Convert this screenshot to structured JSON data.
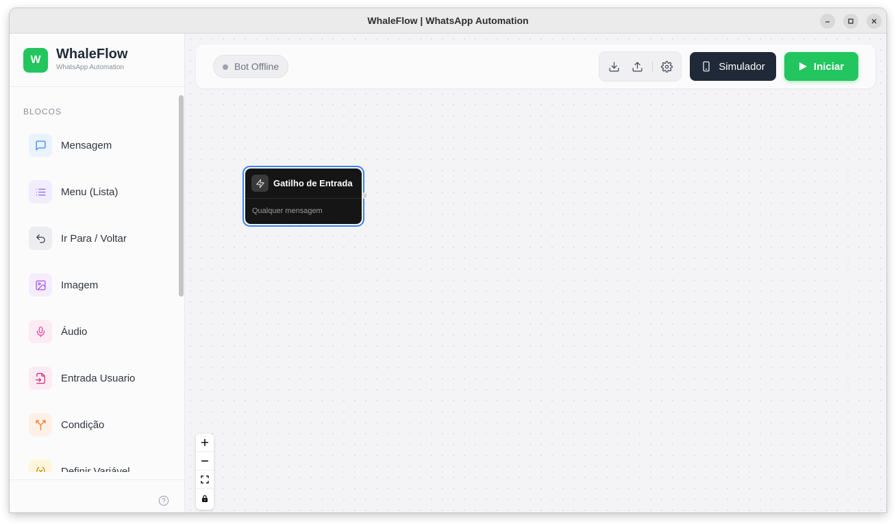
{
  "window": {
    "title": "WhaleFlow | WhatsApp Automation"
  },
  "brand": {
    "logo_letter": "W",
    "name": "WhaleFlow",
    "subtitle": "WhatsApp Automation",
    "accent": "#22c55e"
  },
  "sidebar": {
    "section_label": "BLOCOS",
    "items": [
      {
        "label": "Mensagem",
        "icon": "message-square-icon",
        "color": "#3b82f6",
        "bg": "#eaf2fe"
      },
      {
        "label": "Menu (Lista)",
        "icon": "list-icon",
        "color": "#8b5cf6",
        "bg": "#f1ecfe"
      },
      {
        "label": "Ir Para / Voltar",
        "icon": "undo-arrow-icon",
        "color": "#374151",
        "bg": "#ededef"
      },
      {
        "label": "Imagem",
        "icon": "image-icon",
        "color": "#a855f7",
        "bg": "#f5ecfe"
      },
      {
        "label": "Áudio",
        "icon": "microphone-icon",
        "color": "#ec4899",
        "bg": "#fdebf3"
      },
      {
        "label": "Entrada Usuario",
        "icon": "file-input-icon",
        "color": "#db2777",
        "bg": "#fdebf3"
      },
      {
        "label": "Condição",
        "icon": "split-icon",
        "color": "#f97316",
        "bg": "#fef0e6"
      },
      {
        "label": "Definir Variável",
        "icon": "variable-icon",
        "color": "#ca8a04",
        "bg": "#fdf6dd"
      }
    ]
  },
  "topbar": {
    "status_label": "Bot Offline",
    "simulator_label": "Simulador",
    "start_label": "Iniciar"
  },
  "node": {
    "title": "Gatilho de Entrada",
    "subtitle": "Qualquer mensagem",
    "selected": true
  }
}
